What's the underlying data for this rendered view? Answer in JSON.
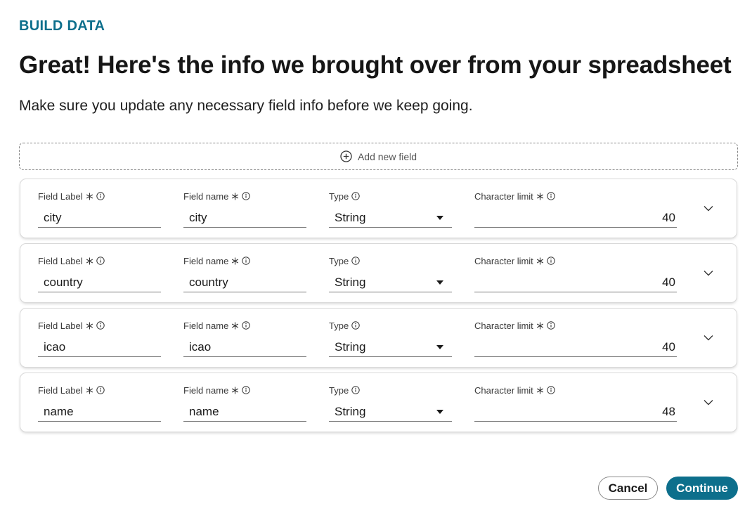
{
  "header": {
    "eyebrow": "BUILD DATA",
    "title": "Great! Here's the info we brought over from your spreadsheet",
    "subtitle": "Make sure you update any necessary field info before we keep going."
  },
  "add_field": {
    "label": "Add new field",
    "icon": "plus-circle-icon"
  },
  "columns": {
    "field_label": "Field Label",
    "field_name": "Field name",
    "type": "Type",
    "char_limit": "Character limit"
  },
  "rows": [
    {
      "field_label": "city",
      "field_name": "city",
      "type": "String",
      "char_limit": "40"
    },
    {
      "field_label": "country",
      "field_name": "country",
      "type": "String",
      "char_limit": "40"
    },
    {
      "field_label": "icao",
      "field_name": "icao",
      "type": "String",
      "char_limit": "40"
    },
    {
      "field_label": "name",
      "field_name": "name",
      "type": "String",
      "char_limit": "48"
    }
  ],
  "actions": {
    "cancel": "Cancel",
    "continue": "Continue"
  },
  "colors": {
    "accent": "#0d6f8c",
    "text": "#161616",
    "border": "#8a8a8a"
  }
}
